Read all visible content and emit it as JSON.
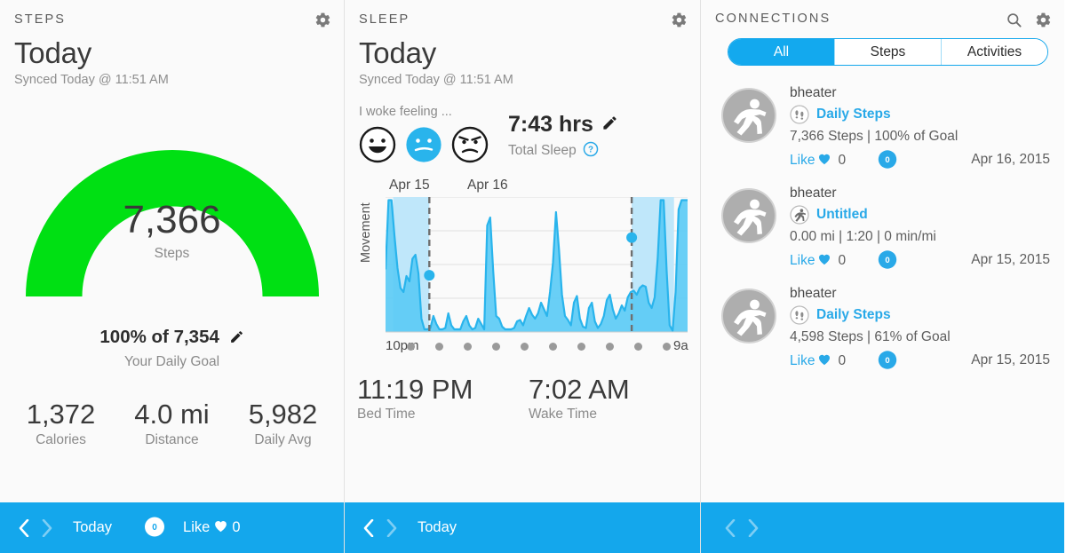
{
  "steps_panel": {
    "kicker": "STEPS",
    "title": "Today",
    "synced": "Synced Today @ 11:51 AM",
    "gear_icon": "gear-icon",
    "gauge": {
      "value": "7,366",
      "unit": "Steps",
      "percent_of_goal": 100,
      "goal_line": "100% of 7,354",
      "goal_sub": "Your Daily Goal",
      "arc_color": "#00e013",
      "edit_icon": "pencil-icon"
    },
    "stats": [
      {
        "value": "1,372",
        "label": "Calories"
      },
      {
        "value": "4.0 mi",
        "label": "Distance"
      },
      {
        "value": "5,982",
        "label": "Daily Avg"
      }
    ],
    "bottom_bar": {
      "prev_icon": "chevron-left-icon",
      "next_icon": "chevron-right-icon",
      "label": "Today",
      "comment_count": "0",
      "like_label": "Like",
      "heart_icon": "heart-icon",
      "like_count": "0"
    }
  },
  "sleep_panel": {
    "kicker": "SLEEP",
    "title": "Today",
    "synced": "Synced Today @ 11:51 AM",
    "gear_icon": "gear-icon",
    "mood": {
      "prompt": "I woke feeling ...",
      "options": [
        {
          "name": "happy",
          "selected": false
        },
        {
          "name": "neutral",
          "selected": true
        },
        {
          "name": "unhappy",
          "selected": false
        }
      ],
      "selected_color": "#29b4ec"
    },
    "total": {
      "hours": "7:43 hrs",
      "label": "Total Sleep",
      "edit_icon": "pencil-icon",
      "help_icon": "help-circle-icon"
    },
    "times": [
      {
        "value": "11:19 PM",
        "label": "Bed Time"
      },
      {
        "value": "7:02 AM",
        "label": "Wake Time"
      }
    ],
    "chart_data": {
      "type": "area",
      "title": "",
      "ylabel": "Movement",
      "xlabel": "",
      "day_labels": [
        "Apr 15",
        "Apr 16"
      ],
      "x_ticks": [
        "10pm",
        "9a"
      ],
      "tick_dots": 10,
      "grid": true,
      "line_color": "#29b4ec",
      "fill_color": "#5ccbf5",
      "awake_band_color": "#bfe7fa",
      "marker_color": "#29b4ec",
      "markers": [
        {
          "label": "Bed Time",
          "x": 0.145,
          "y": 0.42
        },
        {
          "label": "Wake Time",
          "x": 0.815,
          "y": 0.7
        }
      ],
      "awake_bands": [
        {
          "start": 0.025,
          "end": 0.145
        },
        {
          "start": 0.815,
          "end": 0.955
        }
      ],
      "values": [
        0.47,
        0.99,
        0.99,
        0.72,
        0.48,
        0.33,
        0.3,
        0.42,
        0.38,
        0.55,
        0.58,
        0.44,
        0.1,
        0.02,
        0.02,
        0.03,
        0.12,
        0.06,
        0.02,
        0.02,
        0.03,
        0.14,
        0.05,
        0.02,
        0.02,
        0.02,
        0.08,
        0.12,
        0.05,
        0.02,
        0.03,
        0.1,
        0.06,
        0.02,
        0.8,
        0.86,
        0.46,
        0.12,
        0.1,
        0.04,
        0.02,
        0.02,
        0.02,
        0.03,
        0.08,
        0.09,
        0.05,
        0.12,
        0.18,
        0.13,
        0.1,
        0.14,
        0.22,
        0.17,
        0.12,
        0.3,
        0.52,
        0.9,
        0.62,
        0.28,
        0.12,
        0.09,
        0.05,
        0.22,
        0.27,
        0.1,
        0.04,
        0.03,
        0.18,
        0.22,
        0.08,
        0.03,
        0.06,
        0.12,
        0.24,
        0.28,
        0.17,
        0.1,
        0.14,
        0.2,
        0.16,
        0.26,
        0.3,
        0.31,
        0.28,
        0.33,
        0.35,
        0.34,
        0.22,
        0.18,
        0.26,
        0.55,
        0.99,
        0.99,
        0.46,
        0.05,
        0.01,
        0.3,
        0.92,
        0.99,
        0.99,
        0.99
      ]
    },
    "bottom_bar": {
      "prev_icon": "chevron-left-icon",
      "next_icon": "chevron-right-icon",
      "label": "Today"
    }
  },
  "connections_panel": {
    "kicker": "CONNECTIONS",
    "search_icon": "search-icon",
    "gear_icon": "gear-icon",
    "tabs": [
      {
        "label": "All",
        "active": true
      },
      {
        "label": "Steps",
        "active": false
      },
      {
        "label": "Activities",
        "active": false
      }
    ],
    "feed": [
      {
        "user": "bheater",
        "avatar_icon": "runner-avatar-icon",
        "type_icon": "footsteps-icon",
        "type_label": "Daily Steps",
        "meta": "7,366 Steps | 100% of Goal",
        "like_label": "Like",
        "heart_icon": "heart-icon",
        "like_count": "0",
        "comment_count": "0",
        "date": "Apr 16, 2015"
      },
      {
        "user": "bheater",
        "avatar_icon": "runner-avatar-icon",
        "type_icon": "running-icon",
        "type_label": "Untitled",
        "meta": "0.00 mi | 1:20 | 0 min/mi",
        "like_label": "Like",
        "heart_icon": "heart-icon",
        "like_count": "0",
        "comment_count": "0",
        "date": "Apr 15, 2015"
      },
      {
        "user": "bheater",
        "avatar_icon": "runner-avatar-icon",
        "type_icon": "footsteps-icon",
        "type_label": "Daily Steps",
        "meta": "4,598 Steps | 61% of Goal",
        "like_label": "Like",
        "heart_icon": "heart-icon",
        "like_count": "0",
        "comment_count": "0",
        "date": "Apr 15, 2015"
      }
    ],
    "bottom_bar": {
      "prev_icon": "chevron-left-icon",
      "next_icon": "chevron-right-icon"
    }
  },
  "theme": {
    "accent_blue": "#14a7ec",
    "green": "#00e013",
    "chart_blue": "#29b4ec",
    "bg": "#fafafa"
  }
}
